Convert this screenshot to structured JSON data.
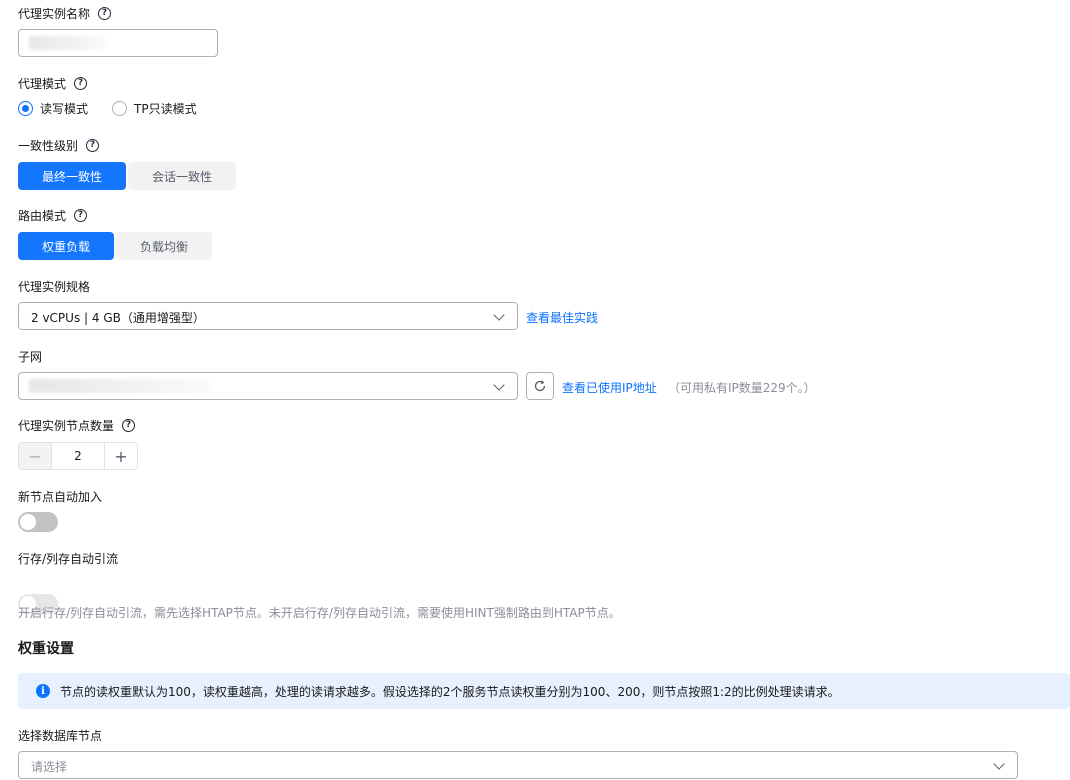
{
  "proxy_name": {
    "label": "代理实例名称",
    "help_icon": "question-icon",
    "value": ""
  },
  "proxy_mode": {
    "label": "代理模式",
    "help_icon": "question-icon",
    "options": [
      {
        "label": "读写模式",
        "checked": true
      },
      {
        "label": "TP只读模式",
        "checked": false
      }
    ]
  },
  "consistency": {
    "label": "一致性级别",
    "help_icon": "question-icon",
    "options": [
      {
        "label": "最终一致性",
        "active": true
      },
      {
        "label": "会话一致性",
        "active": false
      }
    ]
  },
  "routing": {
    "label": "路由模式",
    "help_icon": "question-icon",
    "options": [
      {
        "label": "权重负载",
        "active": true
      },
      {
        "label": "负载均衡",
        "active": false
      }
    ]
  },
  "spec": {
    "label": "代理实例规格",
    "value": "2 vCPUs | 4 GB（通用增强型）",
    "link": "查看最佳实践"
  },
  "subnet": {
    "label": "子网",
    "value": "",
    "link": "查看已使用IP地址",
    "note": "（可用私有IP数量229个。）"
  },
  "node_count": {
    "label": "代理实例节点数量",
    "help_icon": "question-icon",
    "value": "2",
    "minus": "−",
    "plus": "+"
  },
  "auto_join": {
    "label": "新节点自动加入",
    "enabled": false
  },
  "auto_route": {
    "label": "行存/列存自动引流",
    "enabled": false,
    "hint": "开启行存/列存自动引流，需先选择HTAP节点。未开启行存/列存自动引流，需要使用HINT强制路由到HTAP节点。"
  },
  "weight": {
    "title": "权重设置",
    "info": "节点的读权重默认为100，读权重越高，处理的读请求越多。假设选择的2个服务节点读权重分别为100、200，则节点按照1:2的比例处理读请求。",
    "info_icon": "info-icon",
    "select_label": "选择数据库节点",
    "select_placeholder": "请选择"
  },
  "colors": {
    "primary": "#1476ff",
    "toggle_off": "#c2c2c2",
    "toggle_disabled": "#e6e6e6",
    "info_bg": "#e6f0ff"
  }
}
